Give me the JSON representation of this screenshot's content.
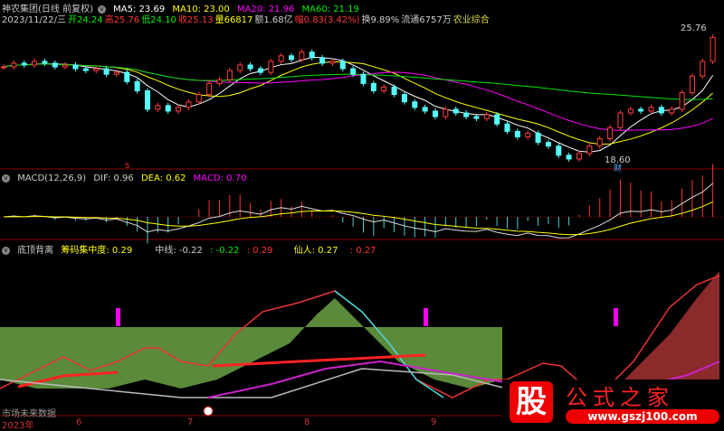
{
  "header": {
    "title": "神农集团(日线 前复权)",
    "ma5": "MA5: 23.69",
    "ma10": "MA10: 23.00",
    "ma20": "MA20: 21.96",
    "ma60": "MA60: 21.19",
    "date": "2023/11/22/三",
    "open": "开24.24",
    "high": "高25.76",
    "low": "低24.10",
    "close": "收25.13",
    "vol": "量66817",
    "amount": "额1.68亿",
    "change": "幅0.83(3.42%)",
    "turnover": "换9.89%",
    "float": "流通6757万",
    "sector": "农业综合"
  },
  "price": {
    "max_label": "25.76",
    "min_label": "18.60",
    "marker_s": "S",
    "marker_cai": "财",
    "closes": [
      23.7,
      23.9,
      23.8,
      24.0,
      23.9,
      23.7,
      23.8,
      23.6,
      23.5,
      23.6,
      23.3,
      23.4,
      22.9,
      22.4,
      21.4,
      21.6,
      21.3,
      21.5,
      21.8,
      22.2,
      22.8,
      23.0,
      23.5,
      23.8,
      23.6,
      23.4,
      24.0,
      24.3,
      24.1,
      24.5,
      24.2,
      23.9,
      24.0,
      23.6,
      23.3,
      22.8,
      22.4,
      22.6,
      22.2,
      21.8,
      21.5,
      21.3,
      21.0,
      21.4,
      21.2,
      21.0,
      20.9,
      21.1,
      20.6,
      20.2,
      19.9,
      20.1,
      19.6,
      19.4,
      18.9,
      18.7,
      19.0,
      19.4,
      19.8,
      20.4,
      21.2,
      21.4,
      21.3,
      21.5,
      21.2,
      21.4,
      22.3,
      23.2,
      24.0,
      25.3
    ],
    "colors": {
      "up": "#ff3c3c",
      "down": "#54fcfc",
      "ma5": "#ffffff",
      "ma10": "#ffff00",
      "ma20": "#ff00ff",
      "ma60": "#00e600"
    }
  },
  "macd": {
    "title": "MACD(12,26,9)",
    "dif": "DIF: 0.96",
    "dea": "DEA: 0.62",
    "macd": "MACD: 0.70"
  },
  "indicator": {
    "title": "底顶背离",
    "chip": "筹码集中度: 0.29",
    "mid_label": "中线: -0.22",
    "v1": ": -0.22",
    "v2": ": 0.29",
    "xian": "仙人: 0.27",
    "v3": ": 0.27",
    "note": "市场未来数据"
  },
  "xaxis": {
    "labels": [
      "2023年",
      "6",
      "7",
      "8",
      "9"
    ]
  },
  "watermark": {
    "char": "股",
    "name": "公式之家",
    "url": "www.gszj100.com"
  }
}
